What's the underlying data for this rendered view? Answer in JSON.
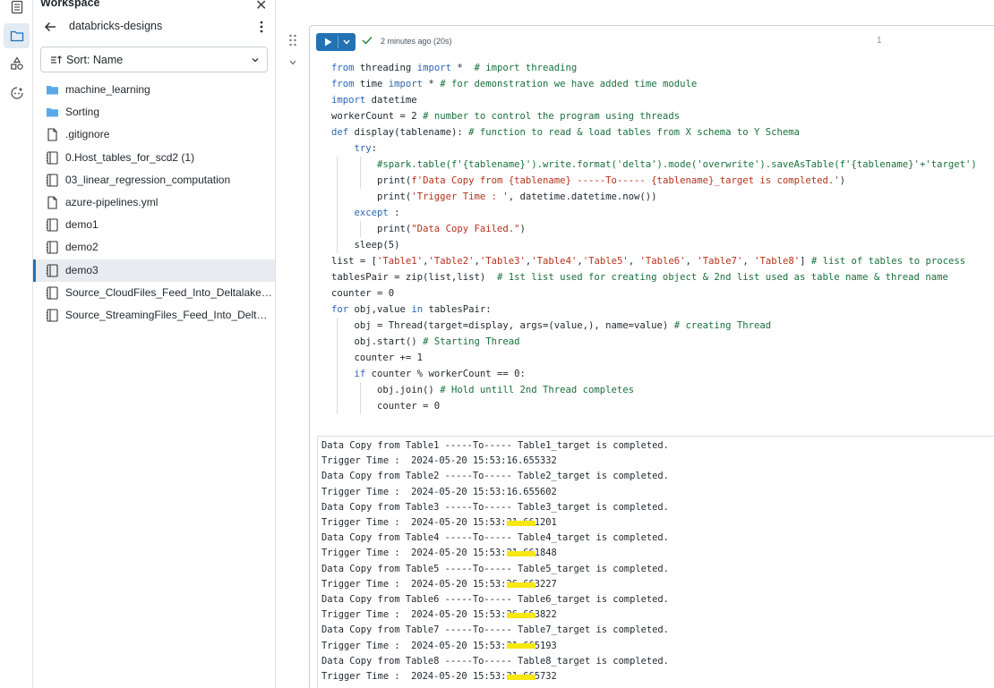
{
  "workspace": {
    "title": "Workspace",
    "folder": "databricks-designs",
    "sort_label": "Sort: Name",
    "items": [
      {
        "label": "machine_learning",
        "icon": "folder-icon"
      },
      {
        "label": "Sorting",
        "icon": "folder-icon"
      },
      {
        "label": ".gitignore",
        "icon": "file-icon"
      },
      {
        "label": "0.Host_tables_for_scd2 (1)",
        "icon": "notebook-icon"
      },
      {
        "label": "03_linear_regression_computation",
        "icon": "notebook-icon"
      },
      {
        "label": "azure-pipelines.yml",
        "icon": "file-icon"
      },
      {
        "label": "demo1",
        "icon": "notebook-icon"
      },
      {
        "label": "demo2",
        "icon": "notebook-icon"
      },
      {
        "label": "demo3",
        "icon": "notebook-icon",
        "selected": true
      },
      {
        "label": "Source_CloudFiles_Feed_Into_Deltalake_SC...",
        "icon": "notebook-icon"
      },
      {
        "label": "Source_StreamingFiles_Feed_Into_Deltalake...",
        "icon": "notebook-icon"
      }
    ]
  },
  "cell": {
    "status": "2 minutes ago (20s)",
    "number": "1",
    "code_lines": [
      "from threading import *  # import threading",
      "from time import * # for demonstration we have added time module",
      "import datetime",
      "workerCount = 2 # number to control the program using threads",
      "def display(tablename): # function to read & load tables from X schema to Y Schema",
      "    try:",
      "        #spark.table(f'{tablename}').write.format('delta').mode('overwrite').saveAsTable(f'{tablename}'+'target')",
      "        print(f'Data Copy from {tablename} -----To----- {tablename}_target is completed.')",
      "        print('Trigger Time : ', datetime.datetime.now())",
      "    except :",
      "        print(\"Data Copy Failed.\")",
      "    sleep(5)",
      "list = ['Table1','Table2','Table3','Table4','Table5', 'Table6', 'Table7', 'Table8'] # list of tables to process",
      "tablesPair = zip(list,list)  # 1st list used for creating object & 2nd list used as table name & thread name",
      "counter = 0",
      "for obj,value in tablesPair:",
      "    obj = Thread(target=display, args=(value,), name=value) # creating Thread",
      "    obj.start() # Starting Thread",
      "    counter += 1",
      "    if counter % workerCount == 0:",
      "        obj.join() # Hold untill 2nd Thread completes",
      "        counter = 0"
    ],
    "output_lines": [
      "Data Copy from Table1 -----To----- Table1_target is completed.",
      "Trigger Time :  2024-05-20 15:53:16.655332",
      "Data Copy from Table2 -----To----- Table2_target is completed.",
      "Trigger Time :  2024-05-20 15:53:16.655602",
      "Data Copy from Table3 -----To----- Table3_target is completed.",
      "Trigger Time :  2024-05-20 15:53:21.661201",
      "Data Copy from Table4 -----To----- Table4_target is completed.",
      "Trigger Time :  2024-05-20 15:53:21.661848",
      "Data Copy from Table5 -----To----- Table5_target is completed.",
      "Trigger Time :  2024-05-20 15:53:26.663227",
      "Data Copy from Table6 -----To----- Table6_target is completed.",
      "Trigger Time :  2024-05-20 15:53:26.663822",
      "Data Copy from Table7 -----To----- Table7_target is completed.",
      "Trigger Time :  2024-05-20 15:53:31.665193",
      "Data Copy from Table8 -----To----- Table8_target is completed.",
      "Trigger Time :  2024-05-20 15:53:31.665732"
    ]
  },
  "colors": {
    "accent": "#2272b4",
    "highlight": "#f7e712",
    "keyword": "#2a66b0",
    "string": "#b5311b",
    "comment": "#19703d"
  }
}
